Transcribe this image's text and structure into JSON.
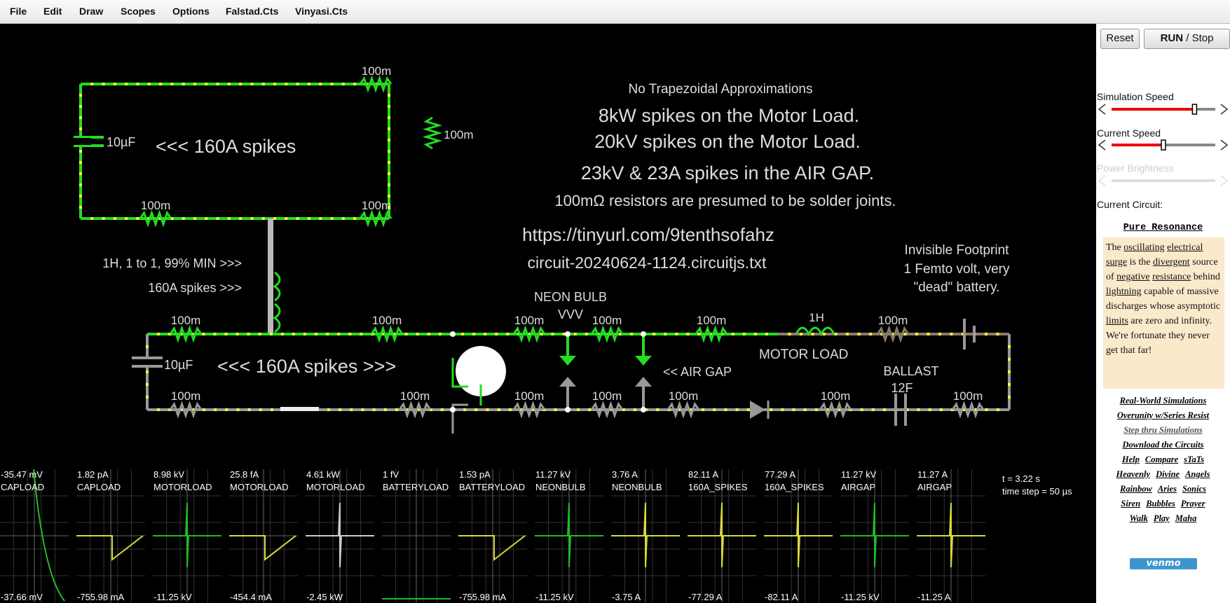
{
  "menu": [
    "File",
    "Edit",
    "Draw",
    "Scopes",
    "Options",
    "Falstad.Cts",
    "Vinyasi.Cts"
  ],
  "buttons": {
    "reset": "Reset",
    "run": "RUN",
    "stop": "/ Stop"
  },
  "sliders": {
    "sim_speed": {
      "label": "Simulation Speed",
      "value": 0.8
    },
    "current_speed": {
      "label": "Current Speed",
      "value": 0.5
    },
    "power_brightness": {
      "label": "Power Brightness",
      "value": 0.5,
      "disabled": true
    }
  },
  "current_circuit_label": "Current Circuit:",
  "circuit_title": "Pure Resonance",
  "description_parts": [
    {
      "t": "The ",
      "u": false
    },
    {
      "t": "oscillating",
      "u": true
    },
    {
      "t": " ",
      "u": false
    },
    {
      "t": "electrical",
      "u": true
    },
    {
      "t": " ",
      "u": false
    },
    {
      "t": "surge",
      "u": true
    },
    {
      "t": " is the ",
      "u": false
    },
    {
      "t": "divergent",
      "u": true
    },
    {
      "t": " source of ",
      "u": false
    },
    {
      "t": "negative",
      "u": true
    },
    {
      "t": " ",
      "u": false
    },
    {
      "t": "resistance",
      "u": true
    },
    {
      "t": " behind ",
      "u": false
    },
    {
      "t": "lightning",
      "u": true
    },
    {
      "t": " capable of massive discharges whose asymptotic ",
      "u": false
    },
    {
      "t": "limits",
      "u": true
    },
    {
      "t": " are zero and infinity. We're fortunate they never get that far!",
      "u": false
    }
  ],
  "links": [
    [
      "Real-World Simulations"
    ],
    [
      "Overunity w/Series Resist"
    ],
    [
      "Step thru Simulations"
    ],
    [
      "Download the Circuits"
    ],
    [
      "Help",
      "Compare",
      "sTaTs"
    ],
    [
      "Heavenly",
      "Divine",
      "Angels"
    ],
    [
      "Rainbow",
      "Aries",
      "Sonics"
    ],
    [
      "Siren",
      "Bubbles",
      "Prayer"
    ],
    [
      "Walk",
      "Play",
      "Maha"
    ]
  ],
  "venmo": "venmo",
  "canvas_text": {
    "t1": "No Trapezoidal Approximations",
    "t2": "8kW spikes on the Motor Load.",
    "t3": "20kV spikes on the Motor Load.",
    "t4": "23kV & 23A spikes in the AIR GAP.",
    "t5": "100mΩ resistors are presumed to be solder joints.",
    "t6": "https://tinyurl.com/9tenthsofahz",
    "t7": "circuit-20240624-1124.circuitjs.txt",
    "inv1": "Invisible Footprint",
    "inv2": "1 Femto volt, very",
    "inv3": "\"dead\" battery.",
    "spikes_top": "<<< 160A spikes",
    "spikes_bottom": "<<< 160A spikes >>>",
    "xfmr1": "1H, 1 to 1, 99% MIN >>>",
    "xfmr2": "160A spikes >>>",
    "neon1": "NEON BULB",
    "neon2": "VVV",
    "airgap": "<< AIR GAP",
    "motor": "MOTOR LOAD",
    "ballast": "BALLAST",
    "cap12": "12F",
    "cap10": "10µF",
    "ind1h": "1H",
    "res": "100m"
  },
  "scopes": [
    {
      "top": "-35.47 mV",
      "name": "CAPLOAD",
      "bottom": "-37.66 mV",
      "color": "#22bb22",
      "shape": "decay"
    },
    {
      "top": "1.82 pA",
      "name": "CAPLOAD",
      "bottom": "-755.98 mA",
      "color": "#d9d93a",
      "shape": "ramp"
    },
    {
      "top": "8.98 kV",
      "name": "MOTORLOAD",
      "bottom": "-11.25 kV",
      "color": "#22bb22",
      "shape": "spike"
    },
    {
      "top": "25.8 fA",
      "name": "MOTORLOAD",
      "bottom": "-454.4 mA",
      "color": "#d9d93a",
      "shape": "ramp"
    },
    {
      "top": "4.61 kW",
      "name": "MOTORLOAD",
      "bottom": "-2.45 kW",
      "color": "#cccccc",
      "shape": "spike"
    },
    {
      "top": "1 fV",
      "name": "BATTERYLOAD",
      "bottom": "",
      "color": "#22bb22",
      "shape": "flat"
    },
    {
      "top": "1.53 pA",
      "name": "BATTERYLOAD",
      "bottom": "-755.98 mA",
      "color": "#d9d93a",
      "shape": "ramp"
    },
    {
      "top": "11.27 kV",
      "name": "NEONBULB",
      "bottom": "-11.25 kV",
      "color": "#22bb22",
      "shape": "spike"
    },
    {
      "top": "3.76 A",
      "name": "NEONBULB",
      "bottom": "-3.75 A",
      "color": "#d9d93a",
      "shape": "spike"
    },
    {
      "top": "82.11 A",
      "name": "160A_SPIKES",
      "bottom": "-77.29 A",
      "color": "#d9d93a",
      "shape": "spike"
    },
    {
      "top": "77.29 A",
      "name": "160A_SPIKES",
      "bottom": "-82.11 A",
      "color": "#d9d93a",
      "shape": "spike"
    },
    {
      "top": "11.27 kV",
      "name": "AIRGAP",
      "bottom": "-11.25 kV",
      "color": "#22bb22",
      "shape": "spike"
    },
    {
      "top": "11.27 A",
      "name": "AIRGAP",
      "bottom": "-11.25 A",
      "color": "#d9d93a",
      "shape": "spike"
    }
  ],
  "time_info": {
    "t": "t = 3.22 s",
    "step": "time step = 50 µs"
  }
}
